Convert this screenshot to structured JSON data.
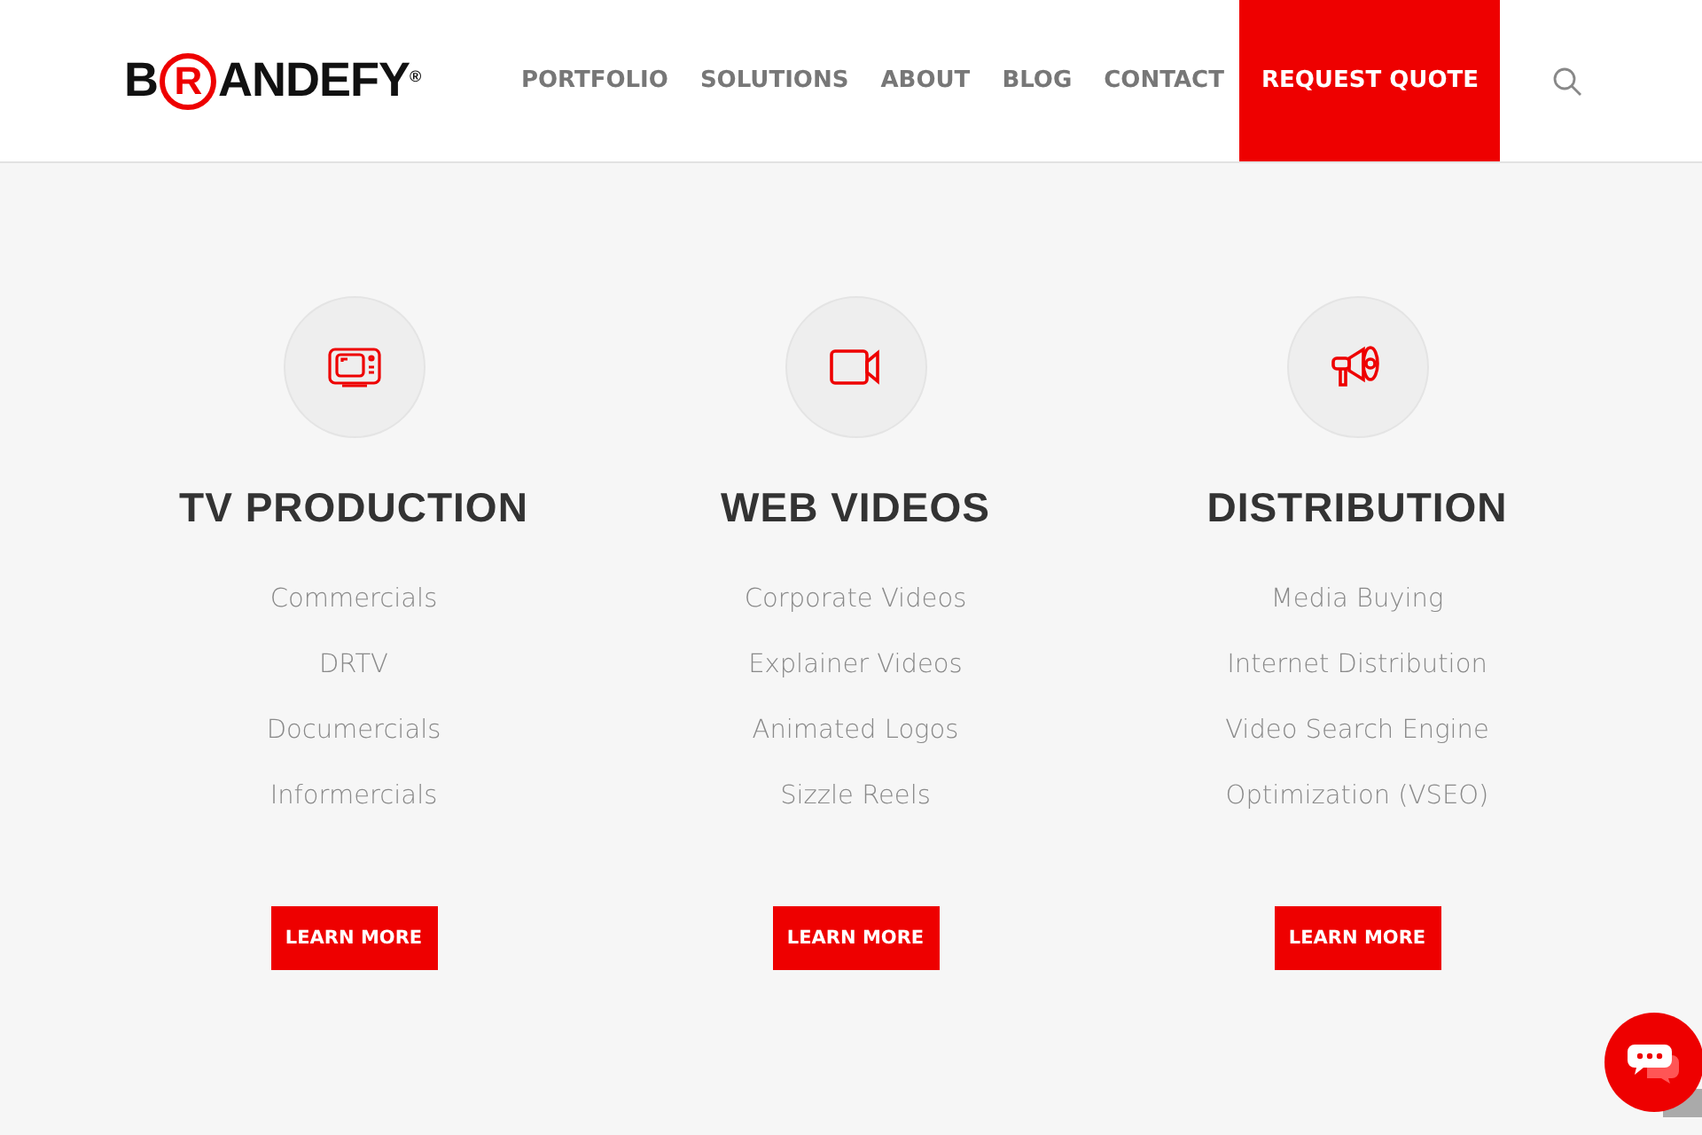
{
  "logo": {
    "before": "B",
    "circled": "R",
    "after": "ANDEFY",
    "mark": "®"
  },
  "nav": [
    {
      "label": "PORTFOLIO",
      "kind": "link"
    },
    {
      "label": "SOLUTIONS",
      "kind": "link"
    },
    {
      "label": "ABOUT",
      "kind": "link"
    },
    {
      "label": "BLOG",
      "kind": "link"
    },
    {
      "label": "CONTACT",
      "kind": "link"
    },
    {
      "label": "REQUEST QUOTE",
      "kind": "cta"
    }
  ],
  "services": [
    {
      "title": "TV PRODUCTION",
      "items": [
        "Commercials",
        "DRTV",
        "Documercials",
        "Informercials"
      ],
      "button": "LEARN MORE"
    },
    {
      "title": "WEB VIDEOS",
      "items": [
        "Corporate Videos",
        "Explainer Videos",
        "Animated Logos",
        "Sizzle Reels"
      ],
      "button": "LEARN MORE"
    },
    {
      "title": "DISTRIBUTION",
      "items": [
        "Media Buying",
        "Internet Distribution",
        "Video Search Engine",
        "Optimization (VSEO)"
      ],
      "button": "LEARN MORE"
    }
  ]
}
